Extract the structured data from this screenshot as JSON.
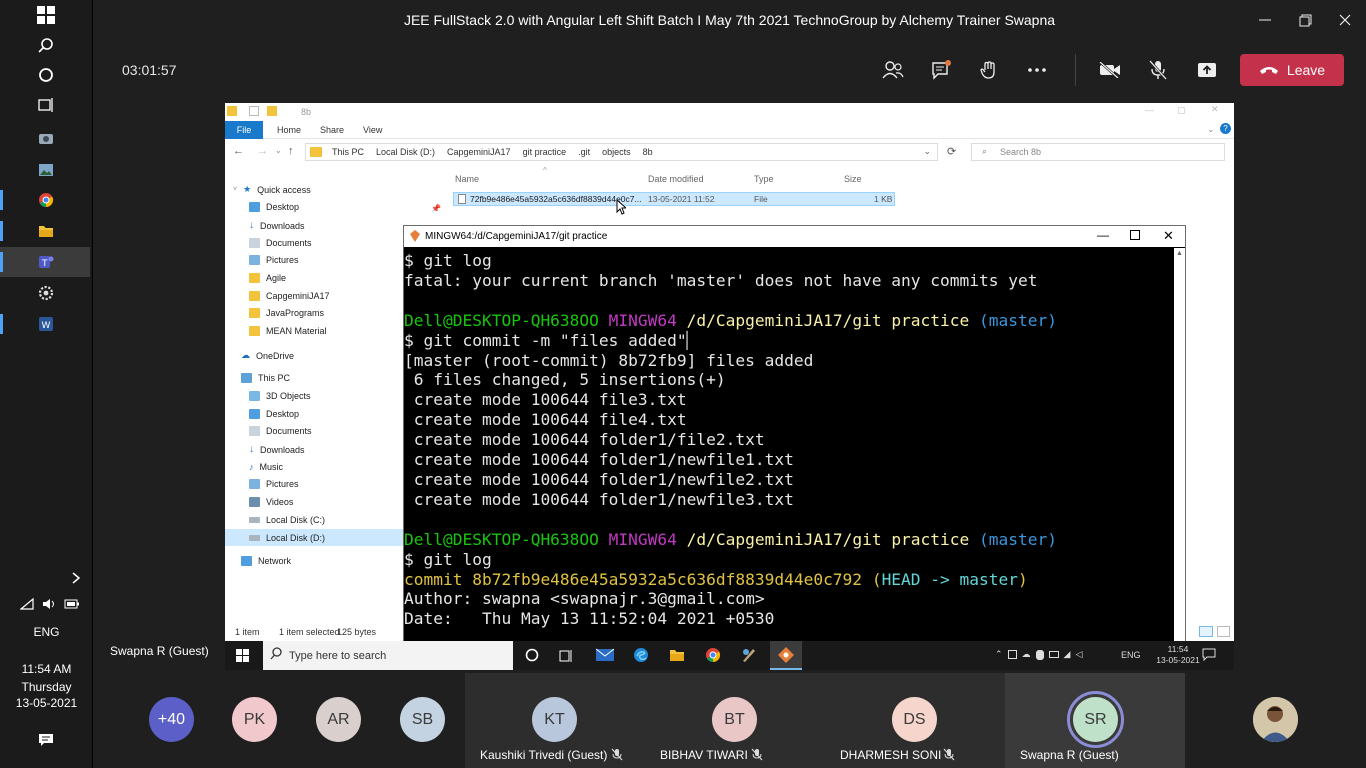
{
  "window": {
    "title": "JEE FullStack 2.0 with Angular Left Shift Batch I May 7th 2021 TechnoGroup by Alchemy Trainer Swapna"
  },
  "meeting": {
    "timer": "03:01:57",
    "leave_label": "Leave",
    "presenter": "Swapna R (Guest)"
  },
  "os_taskbar": {
    "language": "ENG",
    "time": "11:54 AM",
    "day": "Thursday",
    "date": "13-05-2021"
  },
  "explorer": {
    "title": "8b",
    "ribbon_tabs": [
      "File",
      "Home",
      "Share",
      "View"
    ],
    "breadcrumb": [
      "This PC",
      "Local Disk (D:)",
      "CapgeminiJA17",
      "git practice",
      ".git",
      "objects",
      "8b"
    ],
    "search_placeholder": "Search 8b",
    "columns": [
      "Name",
      "Date modified",
      "Type",
      "Size"
    ],
    "file": {
      "name": "72fb9e486e45a5932a5c636df8839d44e0c7...",
      "date": "13-05-2021 11:52",
      "type": "File",
      "size": "1 KB"
    },
    "nav": {
      "quick_access": "Quick access",
      "quick": [
        "Desktop",
        "Downloads",
        "Documents",
        "Pictures",
        "Agile",
        "CapgeminiJA17",
        "JavaPrograms",
        "MEAN Material"
      ],
      "onedrive": "OneDrive",
      "this_pc": "This PC",
      "pc": [
        "3D Objects",
        "Desktop",
        "Documents",
        "Downloads",
        "Music",
        "Pictures",
        "Videos",
        "Local Disk (C:)",
        "Local Disk (D:)"
      ],
      "network": "Network"
    },
    "status": {
      "items": "1 item",
      "selected": "1 item selected",
      "size": "125 bytes"
    }
  },
  "terminal": {
    "title": "MINGW64:/d/CapgeminiJA17/git practice",
    "prompt_user": "Dell@DESKTOP-QH638OO",
    "prompt_env": "MINGW64",
    "prompt_path": "/d/CapgeminiJA17/git practice",
    "prompt_branch": "(master)",
    "lines": {
      "l1": "$ git log",
      "l2": "fatal: your current branch 'master' does not have any commits yet",
      "l4": "$ git commit -m \"files added\"",
      "l5": "[master (root-commit) 8b72fb9] files added",
      "l6": " 6 files changed, 5 insertions(+)",
      "l7": " create mode 100644 file3.txt",
      "l8": " create mode 100644 file4.txt",
      "l9": " create mode 100644 folder1/file2.txt",
      "l10": " create mode 100644 folder1/newfile1.txt",
      "l11": " create mode 100644 folder1/newfile2.txt",
      "l12": " create mode 100644 folder1/newfile3.txt",
      "l15": "$ git log",
      "commit_label": "commit 8b72fb9e486e45a5932a5c636df8839d44e0c792",
      "head_open": "(",
      "head": "HEAD -> master",
      "head_close": ")",
      "author": "Author: swapna <swapnajr.3@gmail.com>",
      "date": "Date:   Thu May 13 11:52:04 2021 +0530"
    }
  },
  "inner_taskbar": {
    "search_placeholder": "Type here to search",
    "language": "ENG",
    "time": "11:54",
    "date": "13-05-2021"
  },
  "participants": {
    "overflow": "+40",
    "avatars": [
      "PK",
      "AR",
      "SB"
    ],
    "tiles": [
      {
        "initials": "KT",
        "name": "Kaushiki Trivedi (Guest)",
        "color": "#b9c7dc"
      },
      {
        "initials": "BT",
        "name": "BIBHAV TIWARI",
        "color": "#e9c7c7"
      },
      {
        "initials": "DS",
        "name": "DHARMESH SONI",
        "color": "#f5d5cc"
      },
      {
        "initials": "SR",
        "name": "Swapna R (Guest)",
        "color": "#bfe0c9"
      }
    ]
  },
  "colors": {
    "leave": "#c4314b",
    "teams_accent": "#6264a7",
    "explorer_accent": "#1979ca"
  }
}
